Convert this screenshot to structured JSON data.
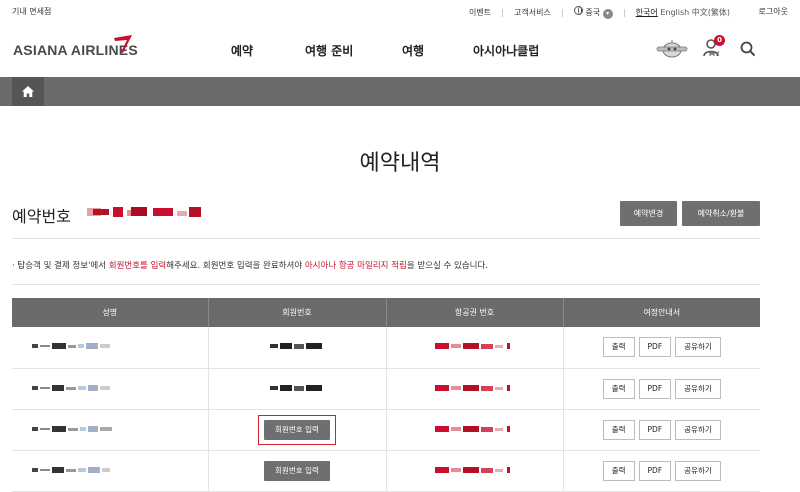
{
  "topbar": {
    "duty_free": "기내 면세점",
    "events": "이벤트",
    "customer_service": "고객서비스",
    "region": "중국",
    "languages": [
      "한국어",
      "English",
      "中文(繁体)"
    ],
    "active_language": "한국어",
    "logout": "로그아웃"
  },
  "header": {
    "logo_text": "ASIANA AIRLINES",
    "nav": [
      "예약",
      "여행 준비",
      "여행",
      "아시아나클럽"
    ],
    "my_badge_count": "0",
    "my_label": "MY",
    "icons": [
      "chatbot-icon",
      "my-page-icon",
      "search-icon"
    ]
  },
  "breadcrumb": {
    "home_icon": "home-icon"
  },
  "page": {
    "title": "예약내역",
    "reservation_label": "예약번호",
    "change_button": "예약변경",
    "cancel_button": "예약취소/환불",
    "notice": {
      "bullet": "·",
      "p1": "탑승객 및 결제 정보'에서 ",
      "p2": "회원번호를 입력",
      "p3": "해주세요. 회원번호 입력을 완료하셔야 ",
      "p4": "아시아나 항공 마일리지 적립",
      "p5": "을 받으실 수 있습니다."
    }
  },
  "table": {
    "headers": [
      "성명",
      "회원번호",
      "항공권 번호",
      "여정안내서"
    ],
    "rows": [
      {
        "member_state": "masked",
        "member_button": ""
      },
      {
        "member_state": "masked",
        "member_button": ""
      },
      {
        "member_state": "button",
        "member_button": "회원번호 입력",
        "highlighted": true
      },
      {
        "member_state": "button",
        "member_button": "회원번호 입력"
      }
    ],
    "actions": {
      "print": "출력",
      "pdf": "PDF",
      "share": "공유하기"
    }
  },
  "colors": {
    "accent_red": "#c8102e",
    "bar_gray": "#6b6b6b"
  }
}
